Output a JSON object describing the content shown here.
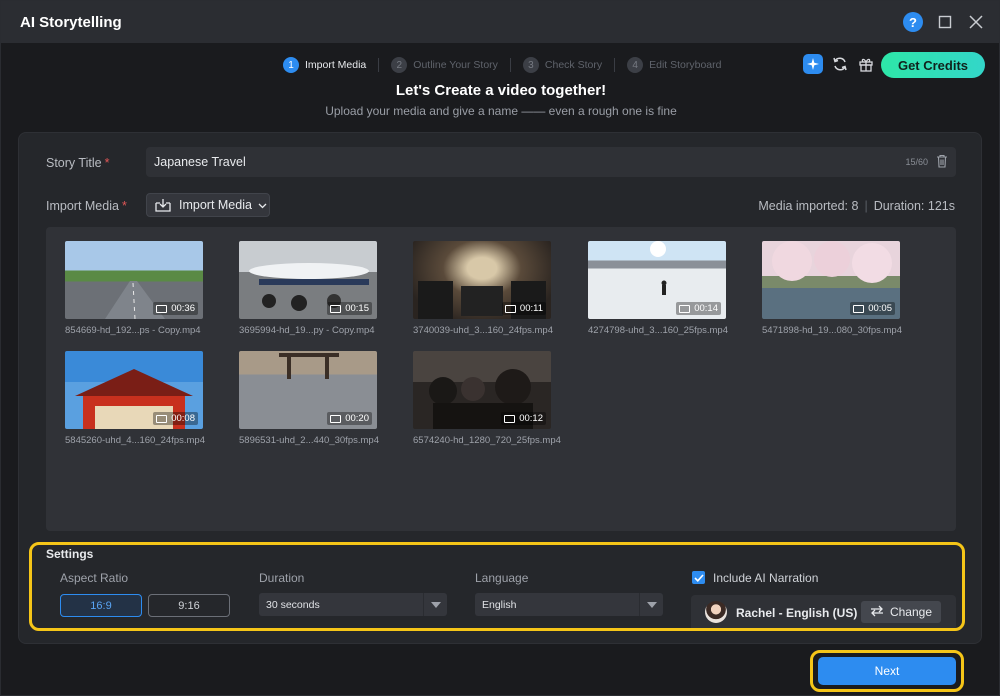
{
  "window": {
    "title": "AI Storytelling"
  },
  "stepper": {
    "steps": [
      {
        "num": "1",
        "label": "Import Media"
      },
      {
        "num": "2",
        "label": "Outline Your Story"
      },
      {
        "num": "3",
        "label": "Check Story"
      },
      {
        "num": "4",
        "label": "Edit Storyboard"
      }
    ],
    "active_index": 0
  },
  "header": {
    "get_credits_label": "Get Credits",
    "headline": "Let's Create a video together!",
    "subline": "Upload your media and give a name —— even a rough one is fine"
  },
  "story": {
    "title_label": "Story Title",
    "title_value": "Japanese Travel",
    "title_count": "15/60",
    "required_mark": "*"
  },
  "import": {
    "label": "Import Media",
    "button_label": "Import Media",
    "media_imported": "Media imported: 8",
    "duration": "Duration: 121s"
  },
  "media": [
    {
      "duration": "00:36",
      "filename": "854669-hd_192...ps - Copy.mp4",
      "scene": "road"
    },
    {
      "duration": "00:15",
      "filename": "3695994-hd_19...py - Copy.mp4",
      "scene": "airport"
    },
    {
      "duration": "00:11",
      "filename": "3740039-uhd_3...160_24fps.mp4",
      "scene": "train"
    },
    {
      "duration": "00:14",
      "filename": "4274798-uhd_3...160_25fps.mp4",
      "scene": "snow"
    },
    {
      "duration": "00:05",
      "filename": "5471898-hd_19...080_30fps.mp4",
      "scene": "sakura"
    },
    {
      "duration": "00:08",
      "filename": "5845260-uhd_4...160_24fps.mp4",
      "scene": "temple"
    },
    {
      "duration": "00:20",
      "filename": "5896531-uhd_2...440_30fps.mp4",
      "scene": "gravel"
    },
    {
      "duration": "00:12",
      "filename": "6574240-hd_1280_720_25fps.mp4",
      "scene": "crowd"
    }
  ],
  "settings": {
    "title": "Settings",
    "aspect_ratio_label": "Aspect Ratio",
    "aspect_options": [
      "16:9",
      "9:16"
    ],
    "aspect_selected": "16:9",
    "duration_label": "Duration",
    "duration_value": "30 seconds",
    "language_label": "Language",
    "language_value": "English",
    "narration_label": "Include AI Narration",
    "narration_checked": true,
    "voice_name": "Rachel - English (US)",
    "change_label": "Change"
  },
  "footer": {
    "next_label": "Next"
  },
  "colors": {
    "accent": "#2d8cf0",
    "credits": "#2ee6a8",
    "highlight": "#f5c518"
  }
}
